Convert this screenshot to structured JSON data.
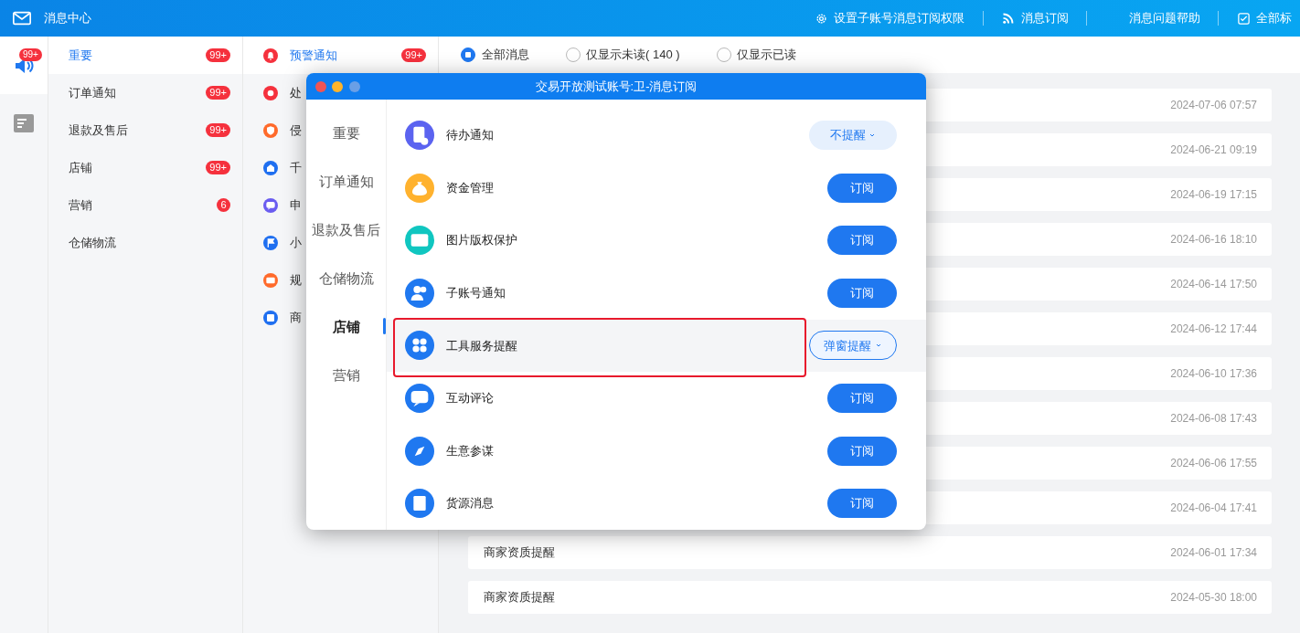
{
  "topbar": {
    "title": "消息中心",
    "actions": [
      {
        "label": "设置子账号消息订阅权限"
      },
      {
        "label": "消息订阅"
      },
      {
        "label": "消息问题帮助"
      },
      {
        "label": "全部标"
      }
    ]
  },
  "rail": [
    {
      "badge": "99+",
      "selected": true
    },
    {
      "selected": false
    }
  ],
  "categories": [
    {
      "label": "重要",
      "badge": "99+",
      "selected": true
    },
    {
      "label": "订单通知",
      "badge": "99+",
      "selected": false
    },
    {
      "label": "退款及售后",
      "badge": "99+",
      "selected": false
    },
    {
      "label": "店铺",
      "badge": "99+",
      "selected": false
    },
    {
      "label": "营销",
      "badge": "6",
      "selected": false
    },
    {
      "label": "仓储物流",
      "selected": false
    }
  ],
  "subcategories": [
    {
      "label": "预警通知",
      "color": "#f5313d",
      "badge": "99+",
      "selected": true
    },
    {
      "label": "处",
      "color": "#f5313d",
      "selected": false
    },
    {
      "label": "侵",
      "color": "#ff6a2b",
      "selected": false
    },
    {
      "label": "千",
      "color": "#1f6ff0",
      "selected": false
    },
    {
      "label": "申",
      "color": "#6a5cf0",
      "selected": false
    },
    {
      "label": "小",
      "color": "#1f6ff0",
      "selected": false
    },
    {
      "label": "规",
      "color": "#ff6a2b",
      "selected": false
    },
    {
      "label": "商",
      "color": "#1f6ff0",
      "selected": false
    }
  ],
  "filters": [
    {
      "label": "全部消息",
      "selected": true
    },
    {
      "label": "仅显示未读( 140 )",
      "selected": false
    },
    {
      "label": "仅显示已读",
      "selected": false
    }
  ],
  "messages": [
    {
      "time": "2024-07-06 07:57"
    },
    {
      "time": "2024-06-21 09:19"
    },
    {
      "time": "2024-06-19 17:15"
    },
    {
      "time": "2024-06-16 18:10"
    },
    {
      "time": "2024-06-14 17:50"
    },
    {
      "time": "2024-06-12 17:44"
    },
    {
      "time": "2024-06-10 17:36"
    },
    {
      "time": "2024-06-08 17:43"
    },
    {
      "time": "2024-06-06 17:55"
    },
    {
      "time": "2024-06-04 17:41"
    },
    {
      "title": "商家资质提醒",
      "time": "2024-06-01 17:34"
    },
    {
      "title": "商家资质提醒",
      "time": "2024-05-30 18:00"
    }
  ],
  "dialog": {
    "title": "交易开放测试账号:卫-消息订阅",
    "nav": [
      {
        "label": "重要",
        "selected": false
      },
      {
        "label": "订单通知",
        "selected": false
      },
      {
        "label": "退款及售后",
        "selected": false
      },
      {
        "label": "仓储物流",
        "selected": false
      },
      {
        "label": "店铺",
        "selected": true
      },
      {
        "label": "营销",
        "selected": false
      }
    ],
    "items": [
      {
        "name": "待办通知",
        "color": "#5b63f0",
        "action": {
          "kind": "dropdown",
          "label": "不提醒"
        },
        "highlighted": false
      },
      {
        "name": "资金管理",
        "color": "#ffb22e",
        "action": {
          "kind": "subscribe",
          "label": "订阅"
        },
        "highlighted": false
      },
      {
        "name": "图片版权保护",
        "color": "#10c6c0",
        "action": {
          "kind": "subscribe",
          "label": "订阅"
        },
        "highlighted": false
      },
      {
        "name": "子账号通知",
        "color": "#1f78f0",
        "action": {
          "kind": "subscribe",
          "label": "订阅"
        },
        "highlighted": false
      },
      {
        "name": "工具服务提醒",
        "color": "#1f78f0",
        "action": {
          "kind": "outline-dropdown",
          "label": "弹窗提醒"
        },
        "highlighted": true
      },
      {
        "name": "互动评论",
        "color": "#1f78f0",
        "action": {
          "kind": "subscribe",
          "label": "订阅"
        },
        "highlighted": false
      },
      {
        "name": "生意参谋",
        "color": "#1f78f0",
        "action": {
          "kind": "subscribe",
          "label": "订阅"
        },
        "highlighted": false
      },
      {
        "name": "货源消息",
        "color": "#1f78f0",
        "action": {
          "kind": "subscribe",
          "label": "订阅"
        },
        "highlighted": false
      }
    ]
  }
}
